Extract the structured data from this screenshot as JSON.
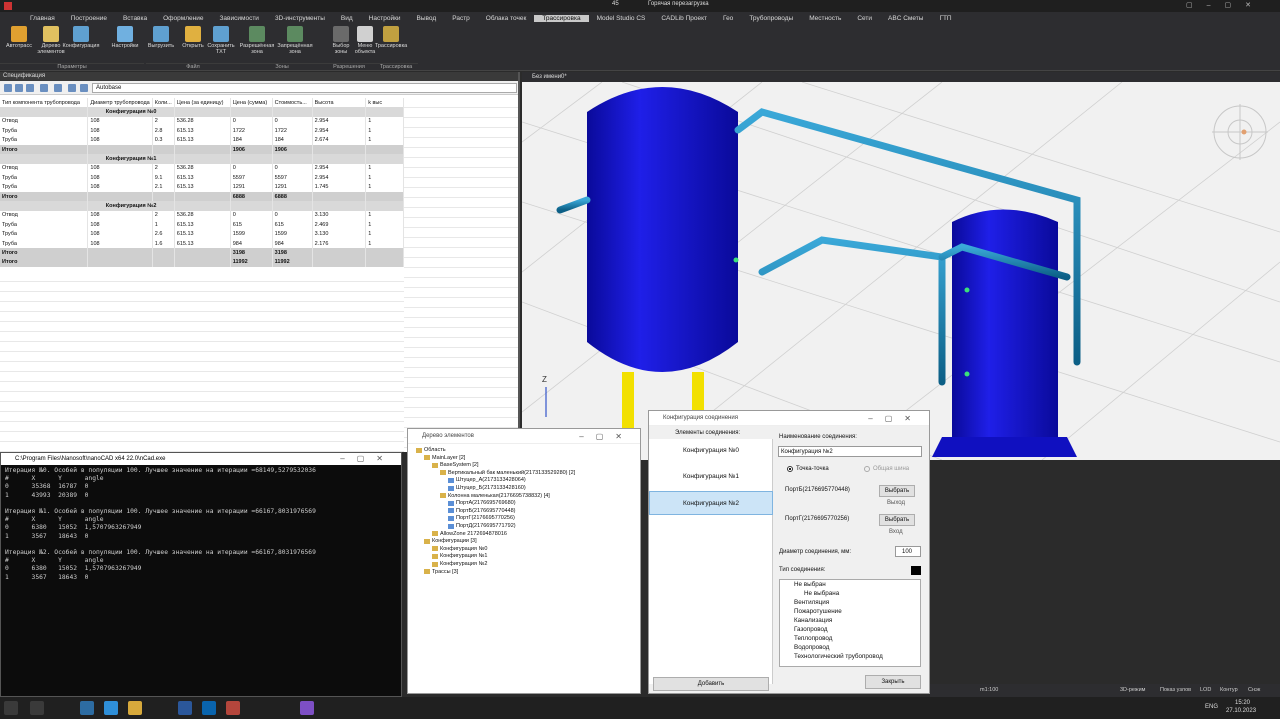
{
  "titlebar": {
    "hot_reload": "Горячая перезагрузка",
    "counter": "45"
  },
  "menu": [
    "Главная",
    "Построение",
    "Вставка",
    "Оформление",
    "Зависимости",
    "3D-инструменты",
    "Вид",
    "Настройки",
    "Вывод",
    "Растр",
    "Облака точек",
    "Трассировка",
    "Model Studio CS",
    "CADLib Проект",
    "Гео",
    "Трубопроводы",
    "Местность",
    "Сети",
    "ABC Сметы",
    "ГТП"
  ],
  "menu_active": "Трассировка",
  "ribbon": {
    "buttons": [
      "Автотрасс",
      "Дерево элементов",
      "Конфигурация",
      "Настройки",
      "Выгрузить",
      "Открыть",
      "Сохранить TXT",
      "Разрешённая зона",
      "Запрещённая зона",
      "Выбор зоны",
      "Меню объекта",
      "Трассировка"
    ],
    "groups": [
      "Параметры",
      "Файл",
      "Зоны",
      "Разрешения",
      "Трассировка"
    ]
  },
  "spec": {
    "title": "Спецификация",
    "combo": "Autobase",
    "headers": [
      "Тип компонента трубопровода",
      "Диаметр трубопровода",
      "Коли...",
      "Цена (за единицу)",
      "Цена (сумма)",
      "Стоимость...",
      "Высота",
      "k выс"
    ],
    "blocks": [
      {
        "title": "Конфигурация №0",
        "rows": [
          [
            "Отвод",
            "108",
            "2",
            "536.28",
            "0",
            "0",
            "2.954",
            "1"
          ],
          [
            "Труба",
            "108",
            "2.8",
            "615.13",
            "1722",
            "1722",
            "2.954",
            "1"
          ],
          [
            "Труба",
            "108",
            "0.3",
            "615.13",
            "184",
            "184",
            "2.674",
            "1"
          ]
        ],
        "total": [
          "Итого",
          "",
          "",
          "",
          "1906",
          "1906",
          "",
          ""
        ]
      },
      {
        "title": "Конфигурация №1",
        "rows": [
          [
            "Отвод",
            "108",
            "2",
            "536.28",
            "0",
            "0",
            "2.954",
            "1"
          ],
          [
            "Труба",
            "108",
            "9.1",
            "615.13",
            "5597",
            "5597",
            "2.954",
            "1"
          ],
          [
            "Труба",
            "108",
            "2.1",
            "615.13",
            "1291",
            "1291",
            "1.745",
            "1"
          ]
        ],
        "total": [
          "Итого",
          "",
          "",
          "",
          "6888",
          "6888",
          "",
          ""
        ]
      },
      {
        "title": "Конфигурация №2",
        "rows": [
          [
            "Отвод",
            "108",
            "2",
            "536.28",
            "0",
            "0",
            "3.130",
            "1"
          ],
          [
            "Труба",
            "108",
            "1",
            "615.13",
            "615",
            "615",
            "2.469",
            "1"
          ],
          [
            "Труба",
            "108",
            "2.6",
            "615.13",
            "1599",
            "1599",
            "3.130",
            "1"
          ],
          [
            "Труба",
            "108",
            "1.6",
            "615.13",
            "984",
            "984",
            "2.176",
            "1"
          ]
        ],
        "total": [
          "Итого",
          "",
          "",
          "",
          "3198",
          "3198",
          "",
          ""
        ]
      }
    ],
    "grand_total": [
      "Итого",
      "",
      "",
      "",
      "11992",
      "11992",
      "",
      ""
    ]
  },
  "viewport": {
    "tab": "Без имени0*",
    "axis_z": "Z"
  },
  "console": {
    "title": "C:\\Program Files\\Nanosoft\\nanoCAD x64 22.0\\nCad.exe",
    "lines": [
      "Итерация №0. Особей в популяции 100. Лучшее значение на итерации =68149,5279532036",
      "#      X      Y      angle",
      "0      35368  16787  0",
      "1      43993  20389  0",
      "",
      "Итерация №1. Особей в популяции 100. Лучшее значение на итерации =66167,8031976569",
      "#      X      Y      angle",
      "0      6380   15052  1,5707963267949",
      "1      3567   18643  0",
      "",
      "Итерация №2. Особей в популяции 100. Лучшее значение на итерации =66167,8031976569",
      "#      X      Y      angle",
      "0      6380   15052  1,5707963267949",
      "1      3567   18643  0"
    ]
  },
  "tree": {
    "title": "Дерево элементов",
    "nodes": [
      {
        "label": "Область",
        "level": 0
      },
      {
        "label": "MainLayer [2]",
        "level": 1
      },
      {
        "label": "BaseSystem [2]",
        "level": 2
      },
      {
        "label": "Вертикальный бак маленький(2173133529280) [2]",
        "level": 3
      },
      {
        "label": "Штуцер_А(2173133428064)",
        "level": 4
      },
      {
        "label": "Штуцер_Б(2173133428160)",
        "level": 4
      },
      {
        "label": "Колонна маленькая(2176695738832) [4]",
        "level": 3
      },
      {
        "label": "ПортА(2176695769680)",
        "level": 4
      },
      {
        "label": "ПортБ(2176695770448)",
        "level": 4
      },
      {
        "label": "ПортГ(2176695770256)",
        "level": 4
      },
      {
        "label": "ПортД(2176695771792)",
        "level": 4
      },
      {
        "label": "AllowZone 2172694878016",
        "level": 2
      },
      {
        "label": "Конфигурации [3]",
        "level": 1
      },
      {
        "label": "Конфигурация №0",
        "level": 2
      },
      {
        "label": "Конфигурация №1",
        "level": 2
      },
      {
        "label": "Конфигурация №2",
        "level": 2
      },
      {
        "label": "Трассы [3]",
        "level": 1
      }
    ]
  },
  "config_dialog": {
    "title": "Конфигурация соединения",
    "list_header": "Элементы соединения:",
    "items": [
      "Конфигурация №0",
      "Конфигурация №1",
      "Конфигурация №2"
    ],
    "selected": 2,
    "add_button": "Добавить",
    "name_label": "Наименование соединения:",
    "name_value": "Конфигурация №2",
    "radio_point": "Точка-точка",
    "radio_bus": "Общая шина",
    "port1": "ПортБ(2176695770448)",
    "port1_side": "Выход",
    "port2": "ПортГ(2176695770256)",
    "port2_side": "Вход",
    "select_button": "Выбрать",
    "diameter_label": "Диаметр соединения, мм:",
    "diameter_value": "100",
    "type_label": "Тип соединения:",
    "types": [
      "Не выбран",
      "Не выбрана",
      "Вентиляция",
      "Пожаротушение",
      "Канализация",
      "Газопровод",
      "Теплопровод",
      "Водопровод",
      "Технологический трубопровод"
    ],
    "close_button": "Закрыть"
  },
  "status": {
    "scale": "m1:100",
    "mode_3d": "3D-режим",
    "show_nodes": "Показ узлов",
    "lod": "LOD",
    "contour": "Контур",
    "snap": "Снэк"
  },
  "taskbar": {
    "time": "15:20",
    "date": "27.10.2023",
    "lang": "ENG"
  }
}
